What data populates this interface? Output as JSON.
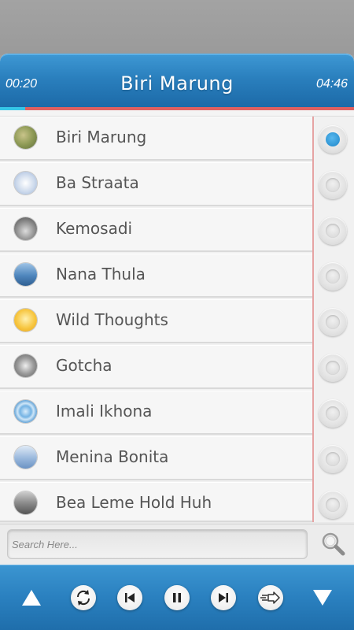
{
  "player": {
    "elapsed": "00:20",
    "total": "04:46",
    "title": "Biri Marung",
    "progress_fraction": 0.07
  },
  "songs": [
    {
      "label": "Biri Marung",
      "selected": true
    },
    {
      "label": "Ba Straata",
      "selected": false
    },
    {
      "label": "Kemosadi",
      "selected": false
    },
    {
      "label": "Nana Thula",
      "selected": false
    },
    {
      "label": "Wild Thoughts",
      "selected": false
    },
    {
      "label": "Gotcha",
      "selected": false
    },
    {
      "label": "Imali Ikhona",
      "selected": false
    },
    {
      "label": "Menina Bonita",
      "selected": false
    },
    {
      "label": "Bea Leme Hold Huh",
      "selected": false
    }
  ],
  "search": {
    "placeholder": "Search Here...",
    "icon": "magnifier-icon"
  },
  "controls": {
    "icons": [
      "scroll-up-icon",
      "repeat-icon",
      "previous-icon",
      "pause-icon",
      "next-icon",
      "shuffle-icon",
      "scroll-down-icon"
    ]
  },
  "colors": {
    "accent_blue": "#2a80bf",
    "progress_fill": "#36c6e8",
    "progress_track": "#e06060",
    "selected_dot": "#1d86c9"
  }
}
